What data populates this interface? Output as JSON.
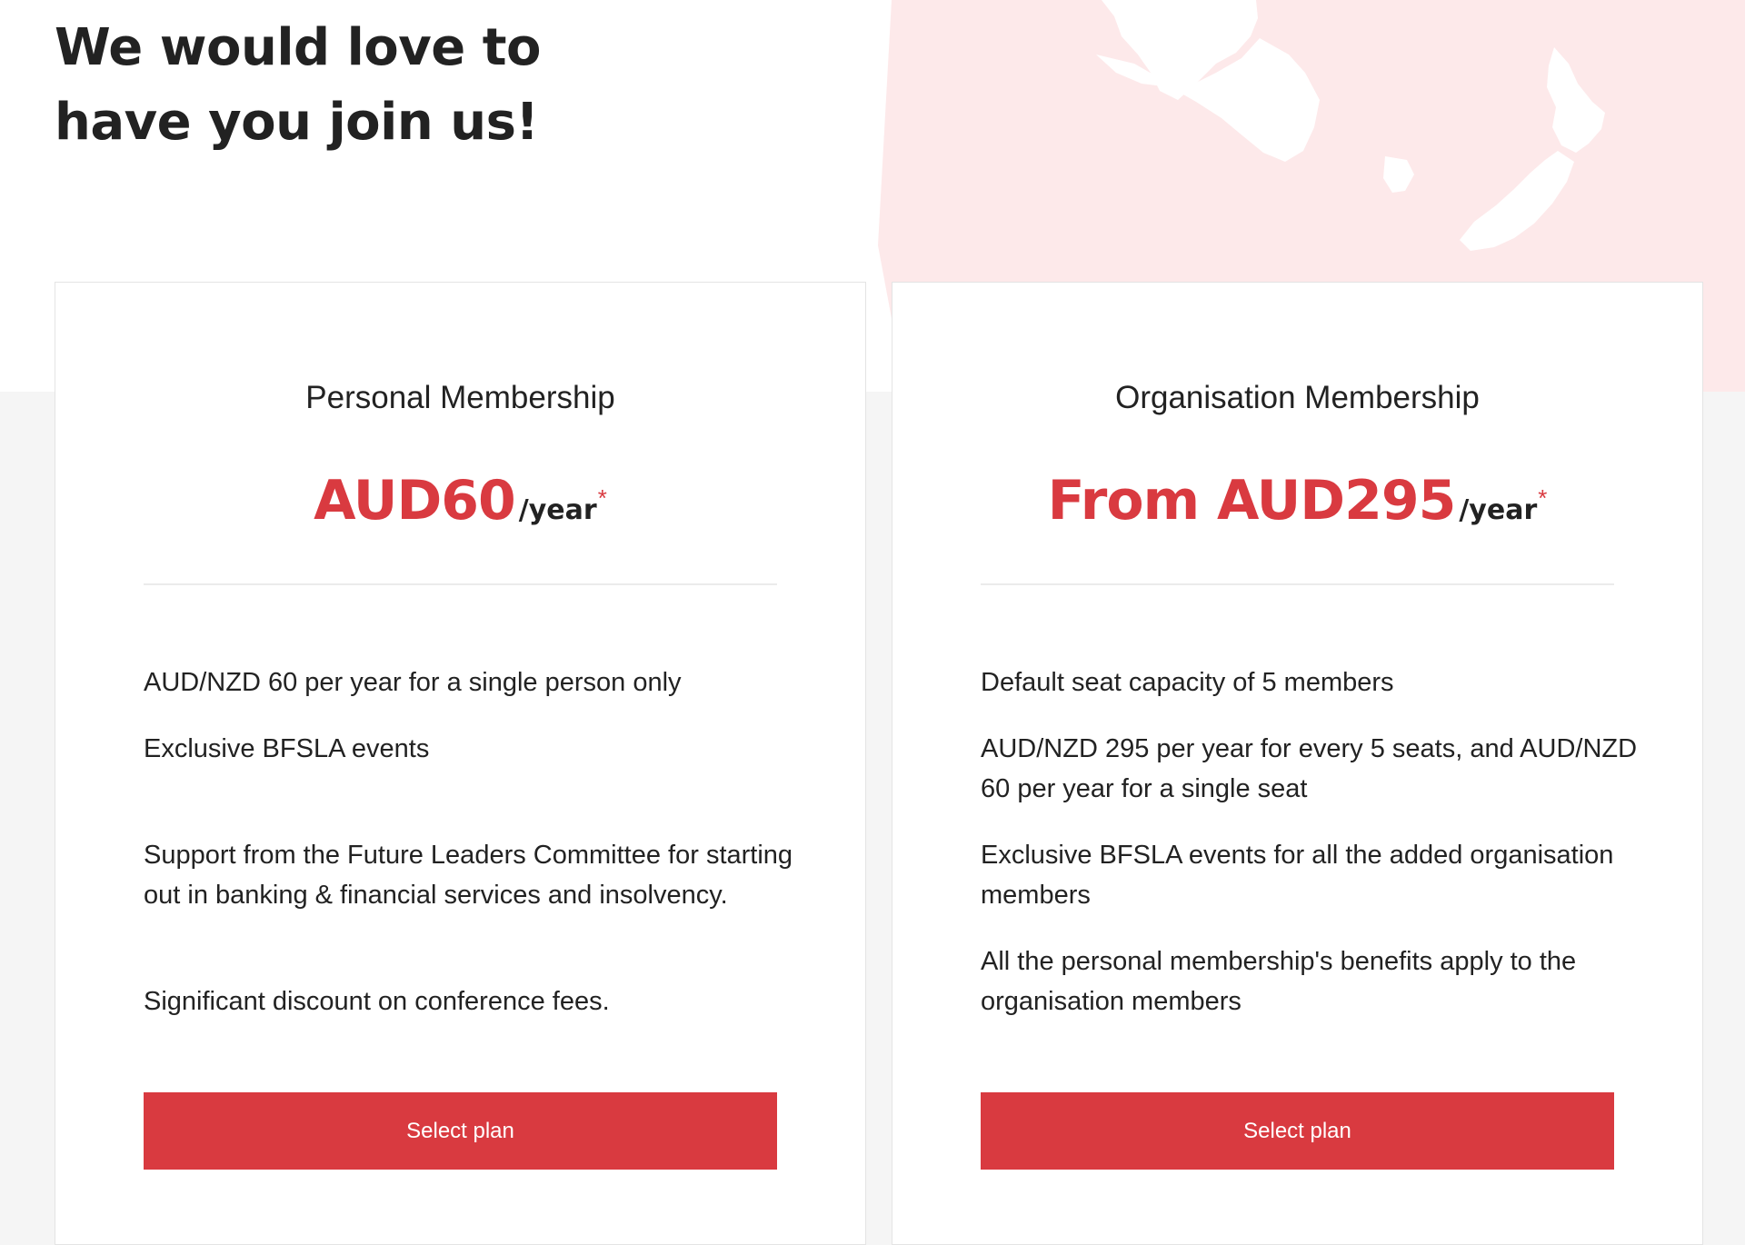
{
  "page": {
    "title_line1": "We would love to",
    "title_line2": "have you join us!"
  },
  "colors": {
    "accent": "#d93a40",
    "map_background": "#fde9ea",
    "page_background": "#f5f5f5",
    "card_background": "#ffffff",
    "text": "#222222"
  },
  "plans": [
    {
      "name": "Personal Membership",
      "price": "AUD60",
      "period": "/year",
      "asterisk": "*",
      "features": [
        "AUD/NZD 60 per year for a single person only",
        "Exclusive BFSLA events",
        "Support from the Future Leaders Committee for starting out in banking & financial services and insolvency.",
        "Significant discount on conference fees."
      ],
      "button_label": "Select plan"
    },
    {
      "name": "Organisation Membership",
      "price": "From AUD295",
      "period": "/year",
      "asterisk": "*",
      "features": [
        "Default seat capacity of 5 members",
        "AUD/NZD 295 per year for every 5 seats, and AUD/NZD 60 per year for a single seat",
        "Exclusive BFSLA events for all the added organisation members",
        "All the personal membership's benefits apply to the organisation members"
      ],
      "button_label": "Select plan"
    }
  ]
}
